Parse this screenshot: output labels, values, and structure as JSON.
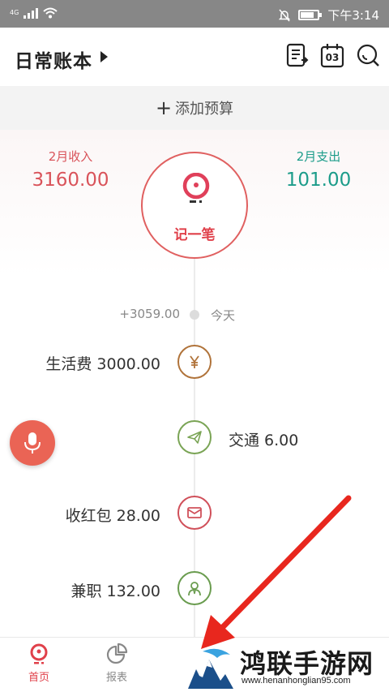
{
  "status_bar": {
    "network": "4G",
    "time": "下午3:14"
  },
  "header": {
    "title": "日常账本",
    "icons": [
      "bill-list-icon",
      "calendar-icon",
      "search-icon"
    ],
    "calendar_day": "03"
  },
  "budget": {
    "label": "添加预算"
  },
  "summary": {
    "income_label": "2月收入",
    "income_value": "3160.00",
    "expense_label": "2月支出",
    "expense_value": "101.00",
    "record_label": "记一笔"
  },
  "day": {
    "total": "+3059.00",
    "label": "今天"
  },
  "entries": [
    {
      "text": "生活费 3000.00",
      "side": "left",
      "icon": "yuan-icon",
      "color": "#b0733a"
    },
    {
      "text": "交通 6.00",
      "side": "right",
      "icon": "paper-plane-icon",
      "color": "#7aa455"
    },
    {
      "text": "收红包 28.00",
      "side": "left",
      "icon": "envelope-icon",
      "color": "#d0505a"
    },
    {
      "text": "兼职 132.00",
      "side": "left",
      "icon": "person-icon",
      "color": "#6a9c4f"
    }
  ],
  "bottom_nav": {
    "items": [
      {
        "label": "首页",
        "active": true
      },
      {
        "label": "报表",
        "active": false
      }
    ]
  },
  "watermark": {
    "title": "鸿联手游网",
    "url": "www.henanhonglian95.com"
  },
  "colors": {
    "income": "#d9535a",
    "expense": "#1c9c8a",
    "accent": "#e0404a",
    "arrow": "#e8271e"
  }
}
